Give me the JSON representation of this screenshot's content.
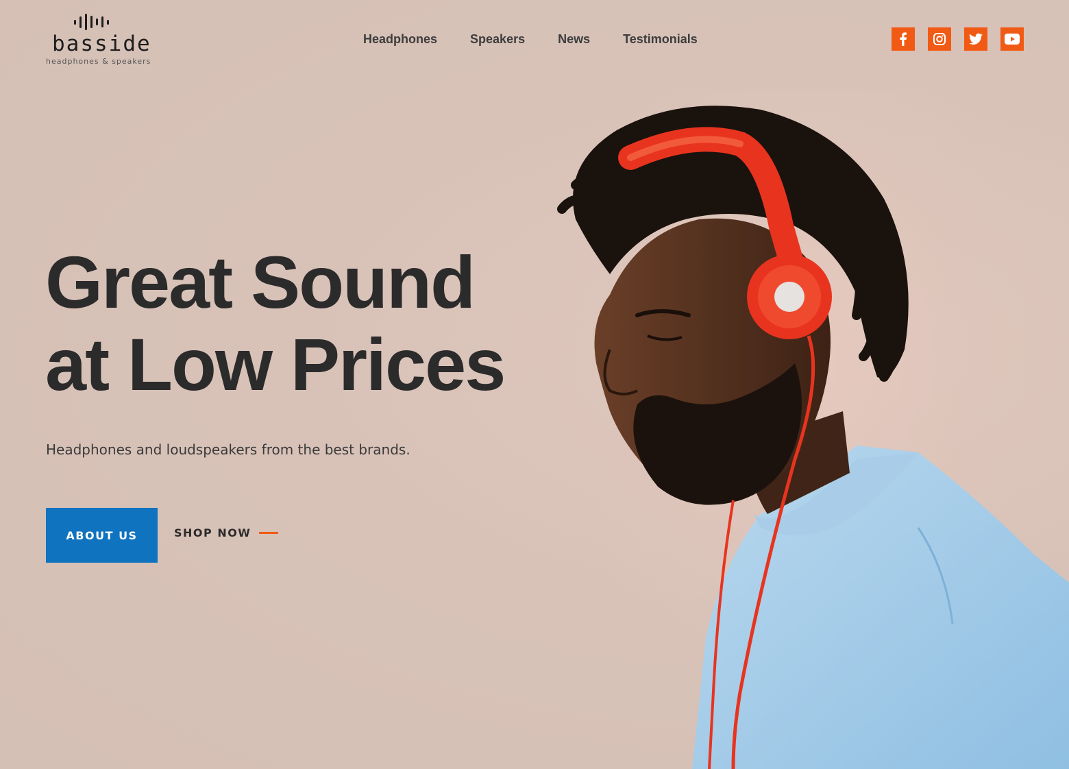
{
  "brand": {
    "name": "basside",
    "tagline": "headphones & speakers",
    "logo_icon": "sound-wave-icon"
  },
  "nav": {
    "items": [
      {
        "label": "Headphones"
      },
      {
        "label": "Speakers"
      },
      {
        "label": "News"
      },
      {
        "label": "Testimonials"
      }
    ]
  },
  "social": [
    {
      "icon": "facebook-icon"
    },
    {
      "icon": "instagram-icon"
    },
    {
      "icon": "twitter-icon"
    },
    {
      "icon": "youtube-icon"
    }
  ],
  "hero": {
    "headline_line1": "Great Sound",
    "headline_line2": "at Low Prices",
    "subtitle": "Headphones and loudspeakers from the best brands.",
    "primary_cta": "ABOUT US",
    "secondary_cta": "SHOP NOW",
    "image": "man-wearing-red-headphones"
  },
  "colors": {
    "background": "#d6c1b7",
    "accent": "#f05a14",
    "primary_button": "#0f73c0",
    "text": "#2c2b2b"
  }
}
